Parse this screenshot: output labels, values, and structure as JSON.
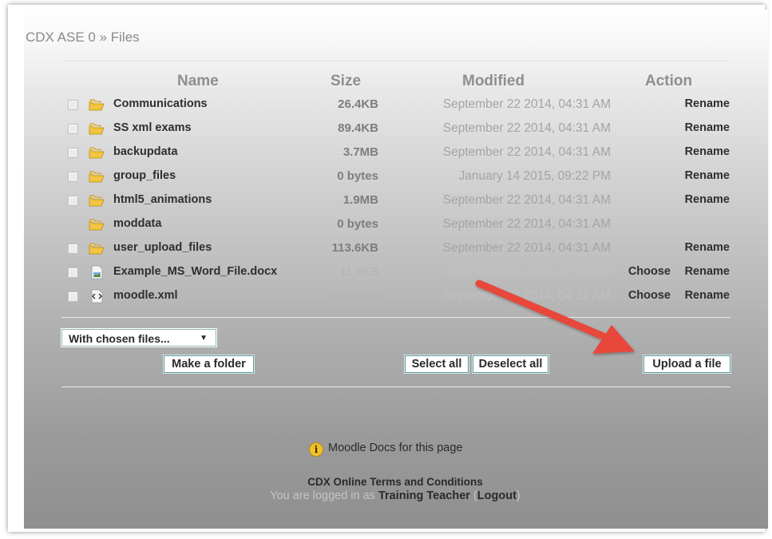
{
  "breadcrumb": "CDX ASE 0 » Files",
  "table": {
    "headers": {
      "name": "Name",
      "size": "Size",
      "modified": "Modified",
      "action": "Action"
    },
    "rows": [
      {
        "name": "Communications",
        "size": "26.4KB",
        "modified": "September 22 2014, 04:31 AM",
        "choose": "",
        "rename": "Rename",
        "icon": "folder-icon",
        "checkbox": true
      },
      {
        "name": "SS xml exams",
        "size": "89.4KB",
        "modified": "September 22 2014, 04:31 AM",
        "choose": "",
        "rename": "Rename",
        "icon": "folder-icon",
        "checkbox": true
      },
      {
        "name": "backupdata",
        "size": "3.7MB",
        "modified": "September 22 2014, 04:31 AM",
        "choose": "",
        "rename": "Rename",
        "icon": "folder-icon",
        "checkbox": true
      },
      {
        "name": "group_files",
        "size": "0 bytes",
        "modified": "January 14 2015, 09:22 PM",
        "choose": "",
        "rename": "Rename",
        "icon": "folder-icon",
        "checkbox": true
      },
      {
        "name": "html5_animations",
        "size": "1.9MB",
        "modified": "September 22 2014, 04:31 AM",
        "choose": "",
        "rename": "Rename",
        "icon": "folder-icon",
        "checkbox": true
      },
      {
        "name": "moddata",
        "size": "0 bytes",
        "modified": "September 22 2014, 04:31 AM",
        "choose": "",
        "rename": "",
        "icon": "folder-icon",
        "checkbox": false
      },
      {
        "name": "user_upload_files",
        "size": "113.6KB",
        "modified": "September 22 2014, 04:31 AM",
        "choose": "",
        "rename": "Rename",
        "icon": "folder-icon",
        "checkbox": true
      },
      {
        "name": "Example_MS_Word_File.docx",
        "size": "11.4KB",
        "modified": "November 21 2016, 07:16 PM",
        "choose": "Choose",
        "rename": "Rename",
        "icon": "document-icon",
        "checkbox": true
      },
      {
        "name": "moodle.xml",
        "size": "125.8KB",
        "modified": "September 22 2014, 04:31 AM",
        "choose": "Choose",
        "rename": "Rename",
        "icon": "xml-file-icon",
        "checkbox": true
      }
    ]
  },
  "controls": {
    "with_chosen": "With chosen files...",
    "with_chosen_arrow": "▼",
    "make_folder": "Make a folder",
    "select_all": "Select all",
    "deselect_all": "Deselect all",
    "upload_file": "Upload a file"
  },
  "annotation": {
    "arrow_color": "#e8463a",
    "icon": "red-arrow-icon"
  },
  "footer": {
    "docs_icon": "info-icon",
    "docs_glyph": "i",
    "docs_link": "Moodle Docs for this page",
    "terms": "CDX Online Terms and Conditions",
    "logged_in_prefix": "You are logged in as",
    "user": "Training Teacher",
    "logout_open": "(",
    "logout": "Logout",
    "logout_close": ")"
  }
}
